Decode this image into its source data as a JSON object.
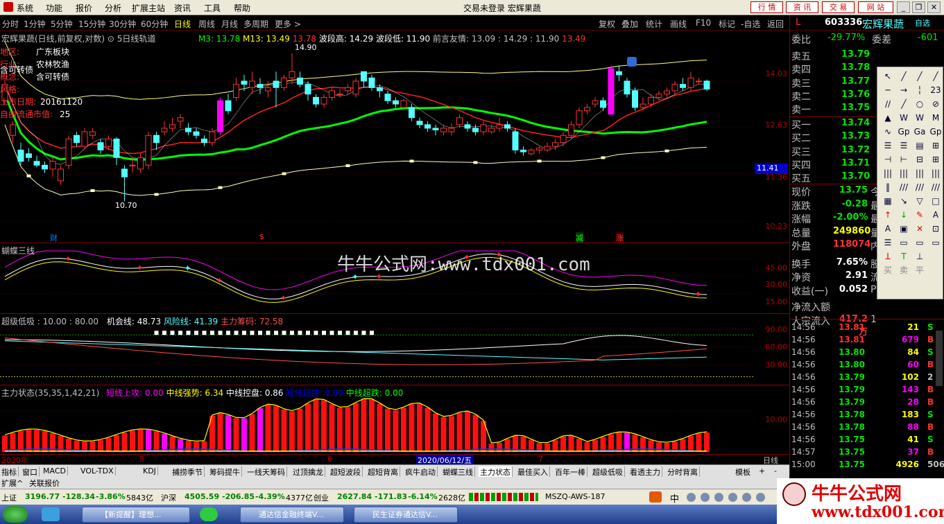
{
  "menu": {
    "items": [
      "系统",
      "功能",
      "报价",
      "分析",
      "扩展主站",
      "资讯",
      "工具",
      "帮助"
    ],
    "title": "交易未登录 宏辉果蔬",
    "right_buttons": [
      "行 情",
      "资 讯",
      "交 易",
      "网 站"
    ]
  },
  "periods": {
    "items": [
      "分时",
      "1分钟",
      "5分钟",
      "15分钟",
      "30分钟",
      "60分钟",
      "日线",
      "周线",
      "月线",
      "多周期",
      "更多 >"
    ],
    "active": "日线",
    "right": [
      "复权",
      "叠加",
      "统计",
      "画线",
      "F10",
      "标记",
      "-自选",
      "返回"
    ]
  },
  "main_chart": {
    "title": "宏辉果蔬(日线,前复权,对数)",
    "indicator": "5日线轨道",
    "m3": "M3: 13.78",
    "m13": "M13: 13.49",
    "v1": "13.78",
    "wave_high": "波段高: 14.29",
    "wave_low": "波段低: 11.90",
    "prev": "前言友情: 13.09 : 14.29 : 11.90",
    "v2": "13.49",
    "info": [
      [
        "地区:",
        "广东板块"
      ],
      [
        "行业:",
        "农林牧渔"
      ],
      [
        "概念:",
        "含可转债"
      ],
      [
        "风格:",
        ""
      ],
      [
        "上市日期:",
        "20161120"
      ],
      [
        "自由流通市值:",
        "25"
      ]
    ],
    "extra_label": "含可转债",
    "high_mark": "14.90",
    "low_mark": "10.70",
    "axis": [
      "14.03",
      "12.63",
      "11.36",
      "10.23"
    ],
    "current_tag": "11.41",
    "markers": [
      "财",
      "$",
      "减",
      "涨"
    ]
  },
  "butterfly": {
    "title": "蝴蝶三线",
    "axis": [
      "45.00",
      "30.00",
      "15.00"
    ]
  },
  "super_low": {
    "title": "超级低吸 : 10.00 : 80.00",
    "chance": "机会线: 48.73",
    "risk": "风险线: 41.39",
    "main": "主力筹码: 72.58",
    "axis": [
      "90.00",
      "60.00",
      "30.00"
    ]
  },
  "main_state": {
    "title": "主力状态(35,35,1,42,21)",
    "short_up": "短线上攻: 0.00",
    "mid_strong": "中线强势: 6.34",
    "mid_ctrl": "中线控盘: 0.86",
    "short_over": "短线超跌: 0.00",
    "mid_over": "中线超跌: 0.00",
    "axis": [
      "10.00"
    ]
  },
  "date_axis": {
    "labels": [
      "2020年",
      "5",
      "6",
      "2020/06/12/五",
      "7"
    ],
    "right": "日线"
  },
  "watermark": "牛牛公式网:www.tdx001.com",
  "quote": {
    "code": "603336",
    "name": "宏辉果蔬",
    "self_select": "自选",
    "flag": "L",
    "weibi_label": "委比",
    "weibi": "-29.77%",
    "weicha_label": "委差",
    "weicha": "-601",
    "asks": [
      [
        "卖五",
        "13.79"
      ],
      [
        "卖四",
        "13.78"
      ],
      [
        "卖三",
        "13.77"
      ],
      [
        "卖二",
        "13.76"
      ],
      [
        "卖一",
        "13.75"
      ]
    ],
    "bids": [
      [
        "买一",
        "13.74"
      ],
      [
        "买二",
        "13.73"
      ],
      [
        "买三",
        "13.72"
      ],
      [
        "买四",
        "13.71"
      ],
      [
        "买五",
        "13.70"
      ]
    ],
    "stats": [
      [
        "现价",
        "13.75",
        "今"
      ],
      [
        "涨跌",
        "-0.28",
        "最"
      ],
      [
        "涨幅",
        "-2.00%",
        "最"
      ],
      [
        "总量",
        "249860",
        "量"
      ],
      [
        "外盘",
        "118074",
        "内"
      ],
      [
        "换手",
        "7.65%",
        "股"
      ],
      [
        "净资",
        "2.91",
        "流"
      ],
      [
        "收益(一)",
        "0.052",
        "P"
      ],
      [
        "净流入额",
        "",
        ""
      ],
      [
        "大宗流入",
        "417.2万",
        "1"
      ]
    ],
    "ticks": [
      [
        "14:56",
        "13.81",
        "21",
        "S"
      ],
      [
        "14:56",
        "13.81",
        "679",
        "B"
      ],
      [
        "14:56",
        "13.80",
        "84",
        "S"
      ],
      [
        "14:56",
        "13.80",
        "60",
        "B"
      ],
      [
        "14:56",
        "13.79",
        "102",
        "2"
      ],
      [
        "14:56",
        "13.79",
        "143",
        "B"
      ],
      [
        "14:56",
        "13.79",
        "28",
        "B"
      ],
      [
        "14:56",
        "13.78",
        "183",
        "S"
      ],
      [
        "14:56",
        "13.78",
        "88",
        "B"
      ],
      [
        "14:56",
        "13.75",
        "41",
        "S"
      ],
      [
        "14:57",
        "13.75",
        "37",
        "B"
      ],
      [
        "15:00",
        "13.75",
        "4926",
        "506"
      ]
    ]
  },
  "tabs": {
    "items": [
      "指标",
      "窗口",
      "MACD",
      "VOL-TDX",
      "KDJ",
      "捕捞季节",
      "筹码提牛",
      "一线天筹码",
      "过顶擒龙",
      "超短波段",
      "超短背离",
      "疯牛启动",
      "蝴蝶三线",
      "主力状态",
      "最佳买入",
      "百年一棒",
      "超级低吸",
      "看透主力",
      "分时背离"
    ],
    "active": "主力状态",
    "right": "模板"
  },
  "tabs2": {
    "items": [
      "扩展^",
      "关联报价"
    ]
  },
  "status": {
    "items": [
      {
        "name": "上证",
        "v": "3196.77",
        "c": "-128.34",
        "p": "-3.86%",
        "a": "5843亿"
      },
      {
        "name": "沪深",
        "v": "4505.59",
        "c": "-206.85",
        "p": "-4.39%",
        "a": "4377亿"
      },
      {
        "name": "创业",
        "v": "2627.84",
        "c": "-171.83",
        "p": "-6.14%",
        "a": "2628亿"
      }
    ],
    "server": "MSZQ-AWS-187",
    "ime": "中"
  },
  "taskbar": {
    "items": [
      "【新提醒】理想...",
      "通达信金融终端V...",
      "民生证券通达信V..."
    ]
  },
  "logo": {
    "text": "牛牛公式网",
    "url": "www.tdx001.com"
  },
  "colors": {
    "up": "#ff3232",
    "down": "#54ffff",
    "yellow": "#ffff00",
    "green": "#00e600",
    "magenta": "#ff00ff"
  }
}
